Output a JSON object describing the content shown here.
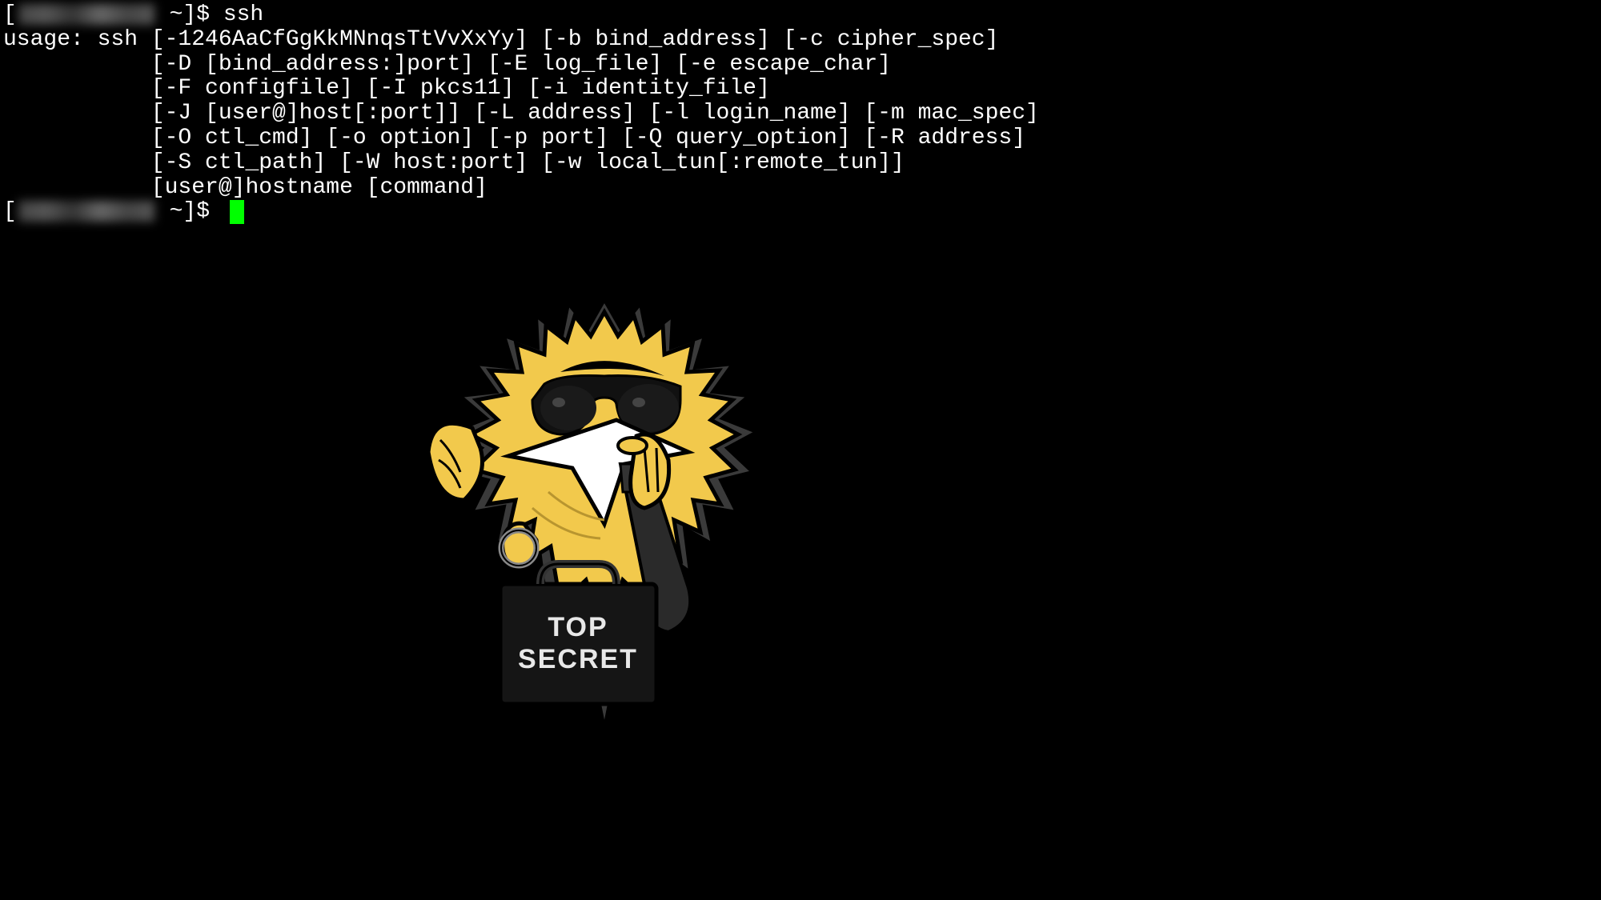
{
  "terminal": {
    "prompt1_prefix": "[",
    "prompt1_suffix": " ~]$ ",
    "command1": "ssh",
    "usage_lines": [
      "usage: ssh [-1246AaCfGgKkMNnqsTtVvXxYy] [-b bind_address] [-c cipher_spec]",
      "           [-D [bind_address:]port] [-E log_file] [-e escape_char]",
      "           [-F configfile] [-I pkcs11] [-i identity_file]",
      "           [-J [user@]host[:port]] [-L address] [-l login_name] [-m mac_spec]",
      "           [-O ctl_cmd] [-o option] [-p port] [-Q query_option] [-R address]",
      "           [-S ctl_path] [-W host:port] [-w local_tun[:remote_tun]]",
      "           [user@]hostname [command]"
    ],
    "prompt2_prefix": "[",
    "prompt2_suffix": " ~]$ "
  },
  "mascot": {
    "briefcase_line1": "TOP",
    "briefcase_line2": "SECRET"
  }
}
